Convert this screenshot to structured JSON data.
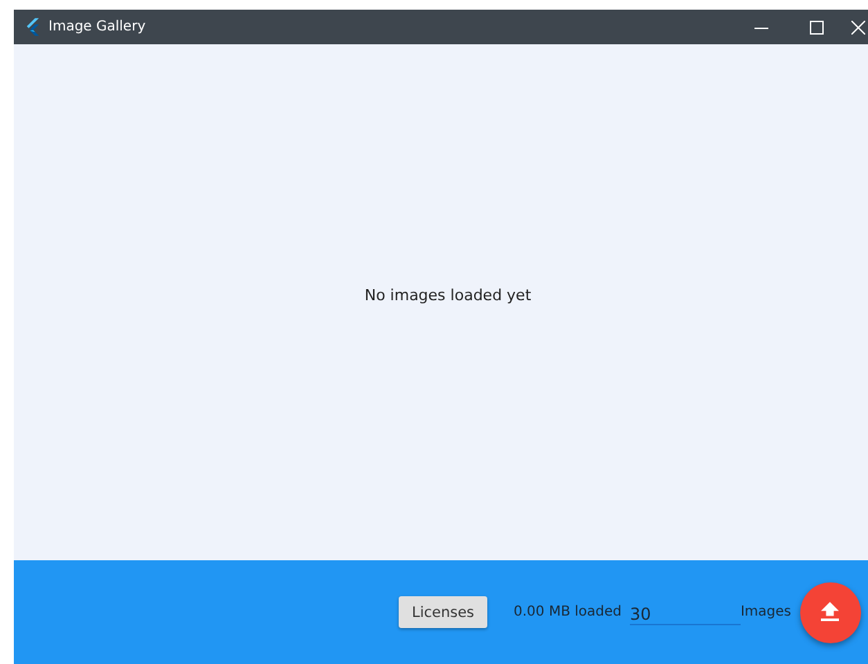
{
  "window": {
    "title": "Image Gallery"
  },
  "content": {
    "message": "No images loaded yet"
  },
  "bottom_bar": {
    "licenses_button": "Licenses",
    "loaded": "0.00 MB loaded",
    "count_field": {
      "value": "30"
    },
    "count_label": "Images"
  }
}
